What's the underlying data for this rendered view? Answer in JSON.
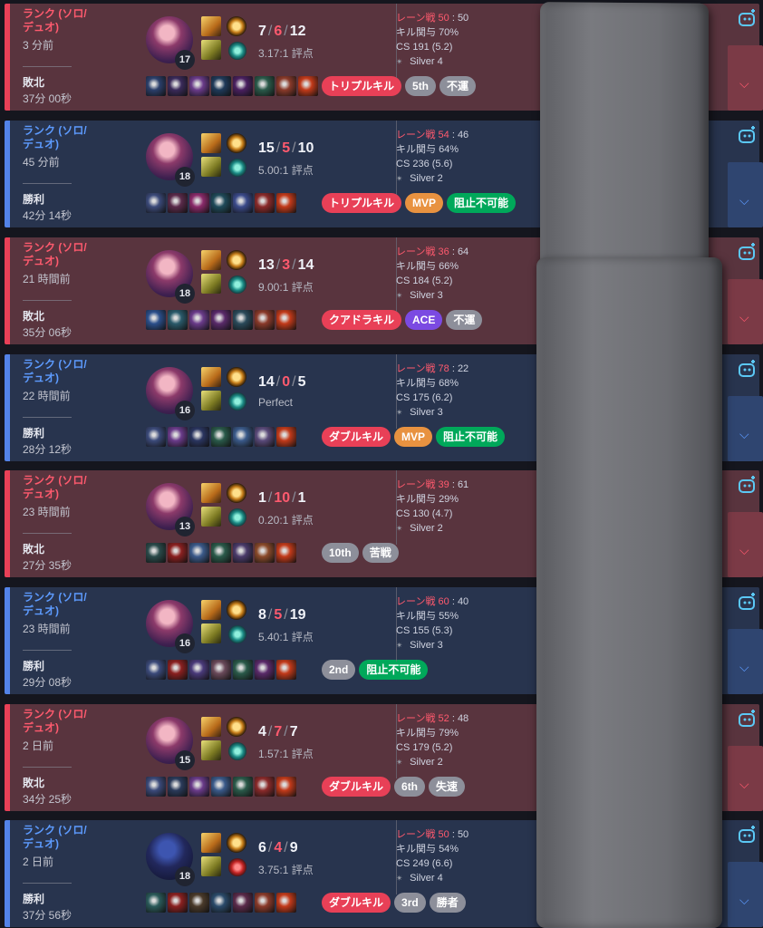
{
  "stats_labels": {
    "lane": "レーン戦",
    "kp": "キル関与",
    "cs": "CS"
  },
  "matches": [
    {
      "outcome": "loss",
      "queue": "ランク (ソロ/デュオ)",
      "time_ago": "3 分前",
      "result": "敗北",
      "duration": "37分 00秒",
      "level": "17",
      "champ_dark": false,
      "kills": "7",
      "deaths": "6",
      "assists": "12",
      "ratio": "3.17:1 評点",
      "lane_score": "50",
      "lane_opp": "50",
      "kill_part": "70%",
      "cs": "191 (5.2)",
      "tier": "Silver 4",
      "tags": [
        {
          "text": "トリプルキル",
          "color": "red"
        },
        {
          "text": "5th",
          "color": "gray"
        },
        {
          "text": "不運",
          "color": "gray"
        }
      ],
      "items": [
        "#2b3f6b",
        "#3a2a5a",
        "#6a3b8a",
        "#1f3a5a",
        "#4a2060",
        "#2a5a4a",
        "#8a3a2a",
        "#c23a1a"
      ]
    },
    {
      "outcome": "win",
      "queue": "ランク (ソロ/デュオ)",
      "time_ago": "45 分前",
      "result": "勝利",
      "duration": "42分 14秒",
      "level": "18",
      "champ_dark": false,
      "kills": "15",
      "deaths": "5",
      "assists": "10",
      "ratio": "5.00:1 評点",
      "lane_score": "54",
      "lane_opp": "46",
      "kill_part": "64%",
      "cs": "236 (5.6)",
      "tier": "Silver 2",
      "tags": [
        {
          "text": "トリプルキル",
          "color": "red"
        },
        {
          "text": "MVP",
          "color": "orange"
        },
        {
          "text": "阻止不可能",
          "color": "green"
        }
      ],
      "items": [
        "#3b4a7a",
        "#5a2a4a",
        "#8a2a6a",
        "#1f4a5a",
        "#3a4a8a",
        "#8a2a2a",
        "#c23a1a"
      ]
    },
    {
      "outcome": "loss",
      "queue": "ランク (ソロ/デュオ)",
      "time_ago": "21 時間前",
      "result": "敗北",
      "duration": "35分 06秒",
      "level": "18",
      "champ_dark": false,
      "kills": "13",
      "deaths": "3",
      "assists": "14",
      "ratio": "9.00:1 評点",
      "lane_score": "36",
      "lane_opp": "64",
      "kill_part": "66%",
      "cs": "184 (5.2)",
      "tier": "Silver 3",
      "tags": [
        {
          "text": "クアドラキル",
          "color": "red"
        },
        {
          "text": "ACE",
          "color": "purple"
        },
        {
          "text": "不運",
          "color": "gray"
        }
      ],
      "items": [
        "#2b4f8b",
        "#2a5a6a",
        "#6a3b8a",
        "#5a2a6a",
        "#2a4a5a",
        "#8a3a2a",
        "#c23a1a"
      ]
    },
    {
      "outcome": "win",
      "queue": "ランク (ソロ/デュオ)",
      "time_ago": "22 時間前",
      "result": "勝利",
      "duration": "28分 12秒",
      "level": "16",
      "champ_dark": false,
      "kills": "14",
      "deaths": "0",
      "assists": "5",
      "ratio": "Perfect",
      "lane_score": "78",
      "lane_opp": "22",
      "kill_part": "68%",
      "cs": "175 (6.2)",
      "tier": "Silver 3",
      "tags": [
        {
          "text": "ダブルキル",
          "color": "red"
        },
        {
          "text": "MVP",
          "color": "orange"
        },
        {
          "text": "阻止不可能",
          "color": "green"
        }
      ],
      "items": [
        "#3b4a7a",
        "#6a3b8a",
        "#2a3560",
        "#2a5a4a",
        "#3a5a8a",
        "#5a4a7a",
        "#c23a1a"
      ]
    },
    {
      "outcome": "loss",
      "queue": "ランク (ソロ/デュオ)",
      "time_ago": "23 時間前",
      "result": "敗北",
      "duration": "27分 35秒",
      "level": "13",
      "champ_dark": false,
      "kills": "1",
      "deaths": "10",
      "assists": "1",
      "ratio": "0.20:1 評点",
      "lane_score": "39",
      "lane_opp": "61",
      "kill_part": "29%",
      "cs": "130 (4.7)",
      "tier": "Silver 2",
      "tags": [
        {
          "text": "10th",
          "color": "gray"
        },
        {
          "text": "苦戦",
          "color": "gray"
        }
      ],
      "items": [
        "#2a4a4a",
        "#8a2020",
        "#3b5a8a",
        "#2a5a4a",
        "#4a3a6a",
        "#8a4a2a",
        "#c23a1a"
      ]
    },
    {
      "outcome": "win",
      "queue": "ランク (ソロ/デュオ)",
      "time_ago": "23 時間前",
      "result": "勝利",
      "duration": "29分 08秒",
      "level": "16",
      "champ_dark": false,
      "kills": "8",
      "deaths": "5",
      "assists": "19",
      "ratio": "5.40:1 評点",
      "lane_score": "60",
      "lane_opp": "40",
      "kill_part": "55%",
      "cs": "155 (5.3)",
      "tier": "Silver 3",
      "tags": [
        {
          "text": "2nd",
          "color": "gray"
        },
        {
          "text": "阻止不可能",
          "color": "green"
        }
      ],
      "items": [
        "#3b4a7a",
        "#8a2020",
        "#4a3a7a",
        "#6a4a5a",
        "#2a5a4a",
        "#5a2a6a",
        "#c23a1a"
      ]
    },
    {
      "outcome": "loss",
      "queue": "ランク (ソロ/デュオ)",
      "time_ago": "2 日前",
      "result": "敗北",
      "duration": "34分 25秒",
      "level": "15",
      "champ_dark": false,
      "kills": "4",
      "deaths": "7",
      "assists": "7",
      "ratio": "1.57:1 評点",
      "lane_score": "52",
      "lane_opp": "48",
      "kill_part": "79%",
      "cs": "179 (5.2)",
      "tier": "Silver 2",
      "tags": [
        {
          "text": "ダブルキル",
          "color": "red"
        },
        {
          "text": "6th",
          "color": "gray"
        },
        {
          "text": "失速",
          "color": "gray"
        }
      ],
      "items": [
        "#3b4a7a",
        "#2a3a5a",
        "#6a3b8a",
        "#3a5a8a",
        "#2a5a4a",
        "#8a2a2a",
        "#c23a1a"
      ]
    },
    {
      "outcome": "win",
      "queue": "ランク (ソロ/デュオ)",
      "time_ago": "2 日前",
      "result": "勝利",
      "duration": "37分 56秒",
      "level": "18",
      "champ_dark": true,
      "kills": "6",
      "deaths": "4",
      "assists": "9",
      "ratio": "3.75:1 評点",
      "lane_score": "50",
      "lane_opp": "50",
      "kill_part": "54%",
      "cs": "249 (6.6)",
      "tier": "Silver 4",
      "tags": [
        {
          "text": "ダブルキル",
          "color": "red"
        },
        {
          "text": "3rd",
          "color": "gray"
        },
        {
          "text": "勝者",
          "color": "gray"
        }
      ],
      "items": [
        "#2a5a5a",
        "#8a2020",
        "#4a3a2a",
        "#2a4a6a",
        "#5a2a4a",
        "#8a3a2a",
        "#c23a1a"
      ]
    }
  ]
}
